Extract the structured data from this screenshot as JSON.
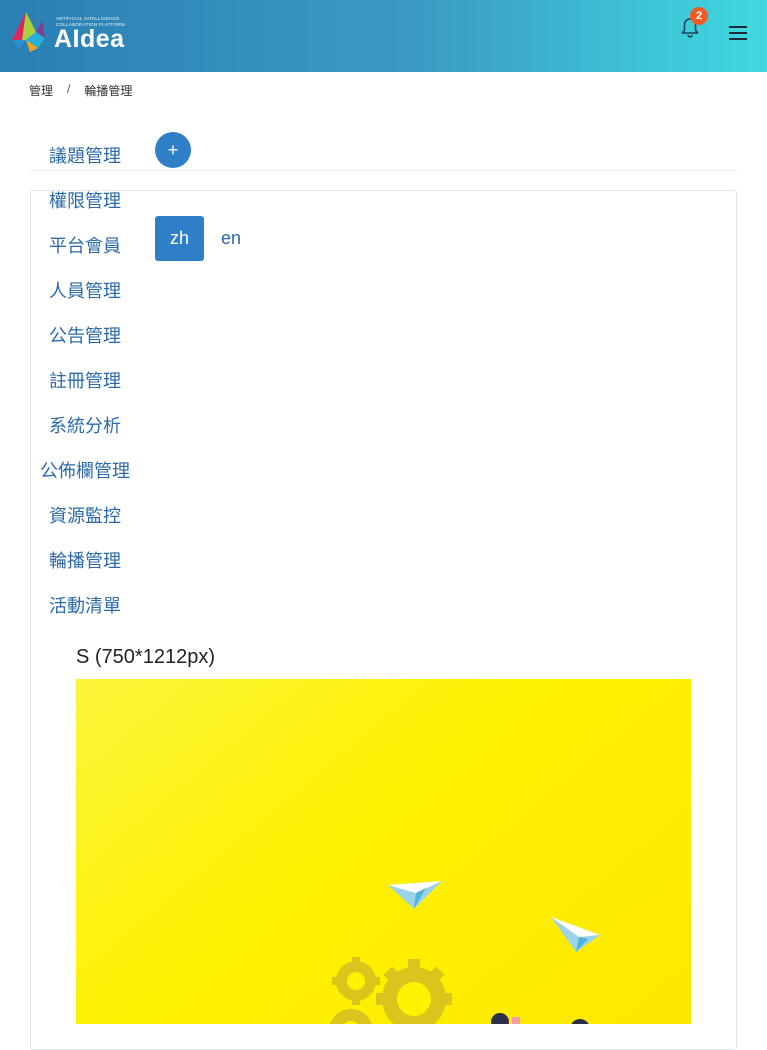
{
  "header": {
    "logo_tagline": "ARTIFICIAL INTELLIGENCE COLLABORATION PLATFORM",
    "logo_word": "AIdea",
    "notification_count": "2",
    "icons": {
      "notifications": "bell-icon",
      "menu": "hamburger-menu-icon"
    }
  },
  "breadcrumb": {
    "root": "管理",
    "separator": "/",
    "current": "輪播管理"
  },
  "sidebar": {
    "items": [
      {
        "label": "議題管理"
      },
      {
        "label": "權限管理"
      },
      {
        "label": "平台會員"
      },
      {
        "label": "人員管理"
      },
      {
        "label": "公告管理"
      },
      {
        "label": "註冊管理"
      },
      {
        "label": "系統分析"
      },
      {
        "label": "公佈欄管理"
      },
      {
        "label": "資源監控"
      },
      {
        "label": "輪播管理"
      },
      {
        "label": "活動清單"
      }
    ]
  },
  "toolbar": {
    "add_label": "+"
  },
  "languages": {
    "active": "zh",
    "other": "en"
  },
  "preview": {
    "size_label": "S (750*1212px)"
  },
  "colors": {
    "primary": "#2e7fc7",
    "link": "#2c6aa8",
    "badge": "#f15a24",
    "banner_yellow": "#fff200"
  }
}
